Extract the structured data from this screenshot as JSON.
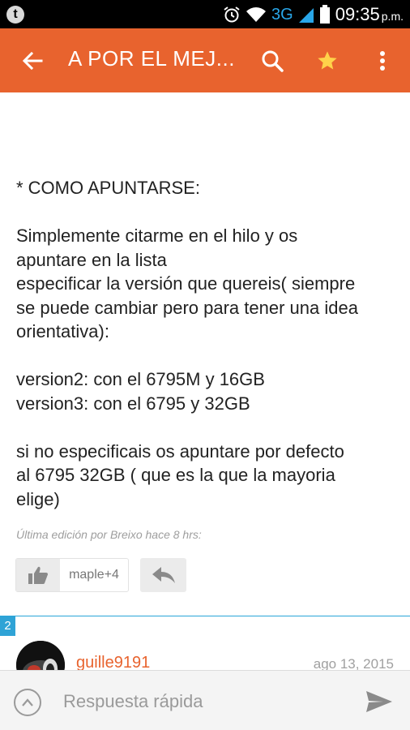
{
  "status_bar": {
    "app_icon_letter": "t",
    "network": "3G",
    "time": "09:35",
    "ampm": "p.m."
  },
  "app_bar": {
    "title": "A POR EL MEJ..."
  },
  "post": {
    "heading": "* COMO APUNTARSE:",
    "paragraph1_line1": "Simplemente citarme en el hilo y os",
    "paragraph1_line2": "apuntare en la lista",
    "paragraph2_line1": "especificar la versión que quereis( siempre",
    "paragraph2_line2": "se puede cambiar pero para tener una idea",
    "paragraph2_line3": "orientativa):",
    "version2": "version2: con el 6795M y 16GB",
    "version3": "version3: con el 6795 y 32GB",
    "paragraph3_line1": "si no especificais os apuntare por defecto",
    "paragraph3_line2": "al 6795 32GB ( que es la que la mayoria",
    "paragraph3_line3": "elige)",
    "edited_note": "Última edición por Breixo hace 8 hrs:",
    "likers": "maple+4"
  },
  "next_post": {
    "number": "2",
    "username": "guille9191",
    "date": "ago 13, 2015"
  },
  "quick_reply": {
    "placeholder": "Respuesta rápida"
  },
  "colors": {
    "accent": "#e8632e",
    "divider": "#29a6d9",
    "status_bar": "#000000"
  }
}
